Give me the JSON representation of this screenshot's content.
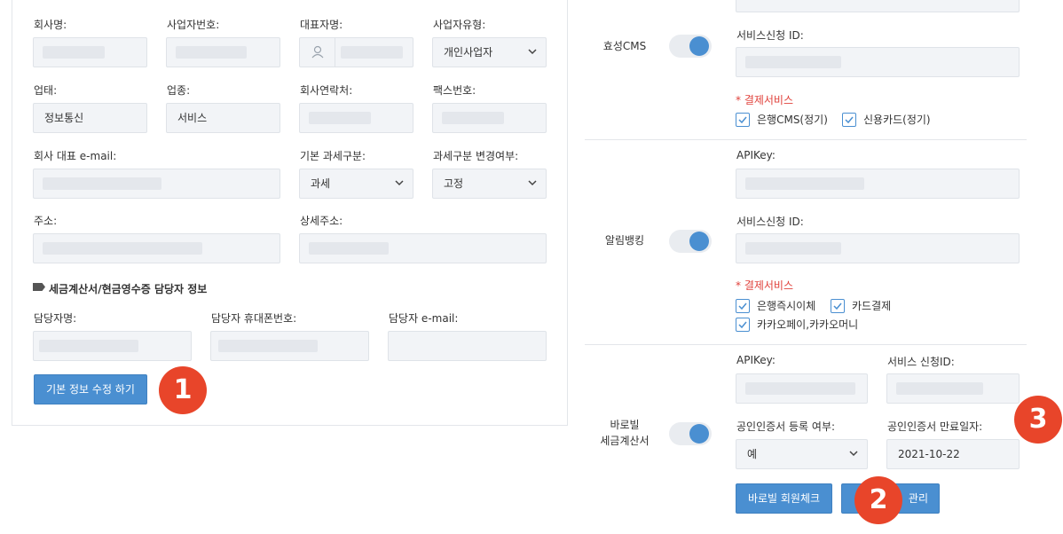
{
  "company": {
    "name_label": "회사명:",
    "bizno_label": "사업자번호:",
    "ceo_label": "대표자명:",
    "biztype_label": "사업자유형:",
    "biztype_value": "개인사업자",
    "category_label": "업태:",
    "category_value": "정보통신",
    "item_label": "업종:",
    "item_value": "서비스",
    "phone_label": "회사연락처:",
    "fax_label": "팩스번호:",
    "email_label": "회사 대표 e-mail:",
    "tax_label": "기본 과세구분:",
    "tax_value": "과세",
    "taxchange_label": "과세구분 변경여부:",
    "taxchange_value": "고정",
    "address_label": "주소:",
    "address_detail_label": "상세주소:"
  },
  "manager": {
    "section_title": "세금계산서/현금영수증 담당자 정보",
    "name_label": "담당자명:",
    "mobile_label": "담당자 휴대폰번호:",
    "email_label": "담당자 e-mail:"
  },
  "actions": {
    "save_basic_label": "기본 정보 수정 하기",
    "barobill_check_label": "바로빌 회원체크",
    "manage_label": "관리"
  },
  "badges": {
    "one": "1",
    "two": "2",
    "three": "3"
  },
  "services": {
    "hyosung": {
      "name": "효성CMS",
      "service_id_label": "서비스신청 ID:",
      "payment_label": "* 결제서비스",
      "options": [
        "은행CMS(정기)",
        "신용카드(정기)"
      ]
    },
    "alrim": {
      "name": "알림뱅킹",
      "apikey_label": "APIKey:",
      "service_id_label": "서비스신청 ID:",
      "payment_label": "* 결제서비스",
      "options": [
        "은행즉시이체",
        "카드결제",
        "카카오페이,카카오머니"
      ]
    },
    "barobill": {
      "name_line1": "바로빌",
      "name_line2": "세금계산서",
      "apikey_label": "APIKey:",
      "service_id_label": "서비스 신청ID:",
      "cert_label": "공인인증서 등록 여부:",
      "cert_value": "예",
      "cert_expiry_label": "공인인증서 만료일자:",
      "cert_expiry_value": "2021-10-22"
    }
  },
  "colors": {
    "accent": "#4a8fd1",
    "badge": "#e8452a",
    "required": "#e0413b",
    "field_bg": "#f2f4f7"
  }
}
